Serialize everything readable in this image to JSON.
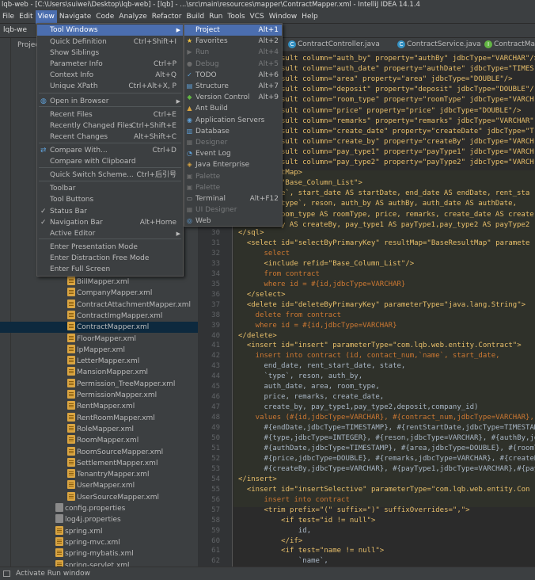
{
  "window": {
    "title": "lqb-web - [C:\\Users\\suiwei\\Desktop\\lqb-web] - [lqb] - ...\\src\\main\\resources\\mapper\\ContractMapper.xml - IntelliJ IDEA 14.1.4"
  },
  "menubar": [
    "File",
    "Edit",
    "View",
    "Navigate",
    "Code",
    "Analyze",
    "Refactor",
    "Build",
    "Run",
    "Tools",
    "VCS",
    "Window",
    "Help"
  ],
  "navbar": {
    "crumb": "lqb-we"
  },
  "project_panel": {
    "header": "Project"
  },
  "tabs": [
    {
      "label": "ContractController.java",
      "icon": "c"
    },
    {
      "label": "ContractService.java",
      "icon": "c"
    },
    {
      "label": "ContractMappe",
      "icon": "i"
    }
  ],
  "view_menu": [
    {
      "label": "Tool Windows",
      "shortcut": "",
      "submenu": true,
      "active": true
    },
    {
      "label": "Quick Definition",
      "shortcut": "Ctrl+Shift+I"
    },
    {
      "label": "Show Siblings",
      "shortcut": ""
    },
    {
      "label": "Parameter Info",
      "shortcut": "Ctrl+P"
    },
    {
      "label": "Context Info",
      "shortcut": "Alt+Q"
    },
    {
      "label": "Unique XPath",
      "shortcut": "Ctrl+Alt+X, P"
    },
    {
      "label": "Open in Browser",
      "shortcut": "",
      "submenu": true,
      "icon": "globe"
    },
    {
      "label": "Recent Files",
      "shortcut": "Ctrl+E"
    },
    {
      "label": "Recently Changed Files",
      "shortcut": "Ctrl+Shift+E"
    },
    {
      "label": "Recent Changes",
      "shortcut": "Alt+Shift+C"
    },
    {
      "label": "Compare With...",
      "shortcut": "Ctrl+D",
      "icon": "compare"
    },
    {
      "label": "Compare with Clipboard",
      "shortcut": ""
    },
    {
      "label": "Quick Switch Scheme...",
      "shortcut": "Ctrl+后引号"
    },
    {
      "label": "Toolbar",
      "shortcut": ""
    },
    {
      "label": "Tool Buttons",
      "shortcut": ""
    },
    {
      "label": "Status Bar",
      "shortcut": "",
      "checked": true
    },
    {
      "label": "Navigation Bar",
      "shortcut": "Alt+Home",
      "checked": true
    },
    {
      "label": "Active Editor",
      "shortcut": "",
      "submenu": true
    },
    {
      "label": "Enter Presentation Mode",
      "shortcut": ""
    },
    {
      "label": "Enter Distraction Free Mode",
      "shortcut": ""
    },
    {
      "label": "Enter Full Screen",
      "shortcut": ""
    }
  ],
  "tool_windows_menu": [
    {
      "label": "Project",
      "shortcut": "Alt+1",
      "active": true
    },
    {
      "label": "Favorites",
      "shortcut": "Alt+2",
      "icon": "★"
    },
    {
      "label": "Run",
      "shortcut": "Alt+4",
      "disabled": true,
      "icon": "▶"
    },
    {
      "label": "Debug",
      "shortcut": "Alt+5",
      "disabled": true,
      "icon": "●"
    },
    {
      "label": "TODO",
      "shortcut": "Alt+6",
      "icon": "✓"
    },
    {
      "label": "Structure",
      "shortcut": "Alt+7",
      "icon": "▤"
    },
    {
      "label": "Version Control",
      "shortcut": "Alt+9",
      "icon": "◆"
    },
    {
      "label": "Ant Build",
      "shortcut": "",
      "icon": "▲"
    },
    {
      "label": "Application Servers",
      "shortcut": "",
      "icon": "◉"
    },
    {
      "label": "Database",
      "shortcut": "",
      "icon": "▥"
    },
    {
      "label": "Designer",
      "shortcut": "",
      "disabled": true,
      "icon": "▦"
    },
    {
      "label": "Event Log",
      "shortcut": "",
      "icon": "◔"
    },
    {
      "label": "Java Enterprise",
      "shortcut": "",
      "icon": "◈"
    },
    {
      "label": "Palette",
      "shortcut": "",
      "disabled": true,
      "icon": "▣"
    },
    {
      "label": "Palette",
      "shortcut": "",
      "disabled": true,
      "icon": "▣"
    },
    {
      "label": "Terminal",
      "shortcut": "Alt+F12",
      "icon": "▭"
    },
    {
      "label": "UI Designer",
      "shortcut": "",
      "disabled": true,
      "icon": "▦"
    },
    {
      "label": "Web",
      "shortcut": "",
      "icon": "◎"
    }
  ],
  "tree_files": [
    {
      "name": "BillMapper.xml",
      "type": "xml"
    },
    {
      "name": "CompanyMapper.xml",
      "type": "xml"
    },
    {
      "name": "ContractAttachmentMapper.xml",
      "type": "xml"
    },
    {
      "name": "ContractImgMapper.xml",
      "type": "xml"
    },
    {
      "name": "ContractMapper.xml",
      "type": "xml",
      "selected": true
    },
    {
      "name": "FloorMapper.xml",
      "type": "xml"
    },
    {
      "name": "IpMapper.xml",
      "type": "xml"
    },
    {
      "name": "LetterMapper.xml",
      "type": "xml"
    },
    {
      "name": "MansionMapper.xml",
      "type": "xml"
    },
    {
      "name": "Permission_TreeMapper.xml",
      "type": "xml"
    },
    {
      "name": "PermissionMapper.xml",
      "type": "xml"
    },
    {
      "name": "RentMapper.xml",
      "type": "xml"
    },
    {
      "name": "RentRoomMapper.xml",
      "type": "xml"
    },
    {
      "name": "RoleMapper.xml",
      "type": "xml"
    },
    {
      "name": "RoomMapper.xml",
      "type": "xml"
    },
    {
      "name": "RoomSourceMapper.xml",
      "type": "xml"
    },
    {
      "name": "SettlementMapper.xml",
      "type": "xml"
    },
    {
      "name": "TenantryMapper.xml",
      "type": "xml"
    },
    {
      "name": "UserMapper.xml",
      "type": "xml"
    },
    {
      "name": "UserSourceMapper.xml",
      "type": "xml"
    },
    {
      "name": "config.properties",
      "type": "prop",
      "indent": 1
    },
    {
      "name": "log4j.properties",
      "type": "prop",
      "indent": 1
    },
    {
      "name": "spring.xml",
      "type": "xml",
      "indent": 1
    },
    {
      "name": "spring-mvc.xml",
      "type": "xml",
      "indent": 1
    },
    {
      "name": "spring-mybatis.xml",
      "type": "xml",
      "indent": 1
    },
    {
      "name": "spring-servlet.xml",
      "type": "xml",
      "indent": 1
    }
  ],
  "code_top": [
    "sult column=\"auth_by\" property=\"authBy\" jdbcType=\"VARCHAR\"/>",
    "sult column=\"auth_date\" property=\"authDate\" jdbcType=\"TIMES",
    "sult column=\"area\" property=\"area\" jdbcType=\"DOUBLE\"/>",
    "sult column=\"deposit\" property=\"deposit\" jdbcType=\"DOUBLE\"/",
    "sult column=\"room_type\" property=\"roomType\" jdbcType=\"VARCH",
    "sult column=\"price\" property=\"price\" jdbcType=\"DOUBLE\"/>",
    "sult column=\"remarks\" property=\"remarks\" jdbcType=\"VARCHAR\"",
    "sult column=\"create_date\" property=\"createDate\" jdbcType=\"T",
    "sult column=\"create_by\" property=\"createBy\" jdbcType=\"VARCH",
    "sult column=\"pay_type1\" property=\"payType1\" jdbcType=\"VARCH",
    "sult column=\"pay_type2\" property=\"payType2\" jdbcType=\"VARCH",
    "tMap>",
    "\"Base_Column_List\">",
    "e`, start_date AS startDate, end_date AS endDate, rent_sta",
    "type`, reson, auth_by AS authBy, auth_date AS authDate,",
    "oom_type AS roomType, price, remarks, create_date AS create",
    "y AS createBy, pay_type1 AS payType1,pay_type2 AS payType2"
  ],
  "code_lines": [
    {
      "n": "30",
      "t": "</sql>"
    },
    {
      "n": "31",
      "t": "  <select id=\"selectByPrimaryKey\" resultMap=\"BaseResultMap\" paramete"
    },
    {
      "n": "32",
      "t": "      select"
    },
    {
      "n": "33",
      "t": "      <include refid=\"Base_Column_List\"/>"
    },
    {
      "n": "34",
      "t": "      from contract"
    },
    {
      "n": "35",
      "t": "      where id = #{id,jdbcType=VARCHAR}"
    },
    {
      "n": "36",
      "t": "  </select>"
    },
    {
      "n": "37",
      "t": "  <delete id=\"deleteByPrimaryKey\" parameterType=\"java.lang.String\">"
    },
    {
      "n": "38",
      "t": "    delete from contract"
    },
    {
      "n": "39",
      "t": "    where id = #{id,jdbcType=VARCHAR}"
    },
    {
      "n": "40",
      "t": "</delete>"
    },
    {
      "n": "41",
      "t": "  <insert id=\"insert\" parameterType=\"com.lqb.web.entity.Contract\">"
    },
    {
      "n": "42",
      "t": "    insert into contract (id, contact_num,`name`, start_date,"
    },
    {
      "n": "43",
      "t": "      end_date, rent_start_date, state,"
    },
    {
      "n": "44",
      "t": "      `type`, reson, auth_by,"
    },
    {
      "n": "45",
      "t": "      auth_date, area, room_type,"
    },
    {
      "n": "46",
      "t": "      price, remarks, create_date,"
    },
    {
      "n": "47",
      "t": "      create_by, pay_type1,pay_type2,deposit,company_id)"
    },
    {
      "n": "48",
      "t": "    values (#{id,jdbcType=VARCHAR}, #{contract_num,jdbcType=VARCHAR},"
    },
    {
      "n": "49",
      "t": "      #{endDate,jdbcType=TIMESTAMP}, #{rentStartDate,jdbcType=TIMESTAM"
    },
    {
      "n": "50",
      "t": "      #{type,jdbcType=INTEGER}, #{reson,jdbcType=VARCHAR}, #{authBy,jd"
    },
    {
      "n": "51",
      "t": "      #{authDate,jdbcType=TIMESTAMP}, #{area,jdbcType=DOUBLE}, #{roomT"
    },
    {
      "n": "52",
      "t": "      #{price,jdbcType=DOUBLE}, #{remarks,jdbcType=VARCHAR}, #{createD"
    },
    {
      "n": "53",
      "t": "      #{createBy,jdbcType=VARCHAR}, #{payType1,jdbcType=VARCHAR},#{pay"
    },
    {
      "n": "54",
      "t": "</insert>"
    },
    {
      "n": "55",
      "t": "  <insert id=\"insertSelective\" parameterType=\"com.lqb.web.entity.Con"
    },
    {
      "n": "56",
      "t": "      insert into contract"
    },
    {
      "n": "57",
      "t": "      <trim prefix=\"(\" suffix=\")\" suffixOverrides=\",\">"
    },
    {
      "n": "58",
      "t": "          <if test=\"id != null\">"
    },
    {
      "n": "59",
      "t": "              id,"
    },
    {
      "n": "60",
      "t": "          </if>"
    },
    {
      "n": "61",
      "t": "          <if test=\"name != null\">"
    },
    {
      "n": "62",
      "t": "              `name`,"
    },
    {
      "n": "63",
      "t": "          </if>"
    }
  ],
  "status": {
    "message": "Activate Run window"
  },
  "colors": {
    "accent": "#4b6eaf",
    "background": "#2b2b2b",
    "panel": "#3c3f41",
    "tag": "#e8bf6a",
    "keyword": "#cc7832",
    "string": "#6a8759"
  }
}
